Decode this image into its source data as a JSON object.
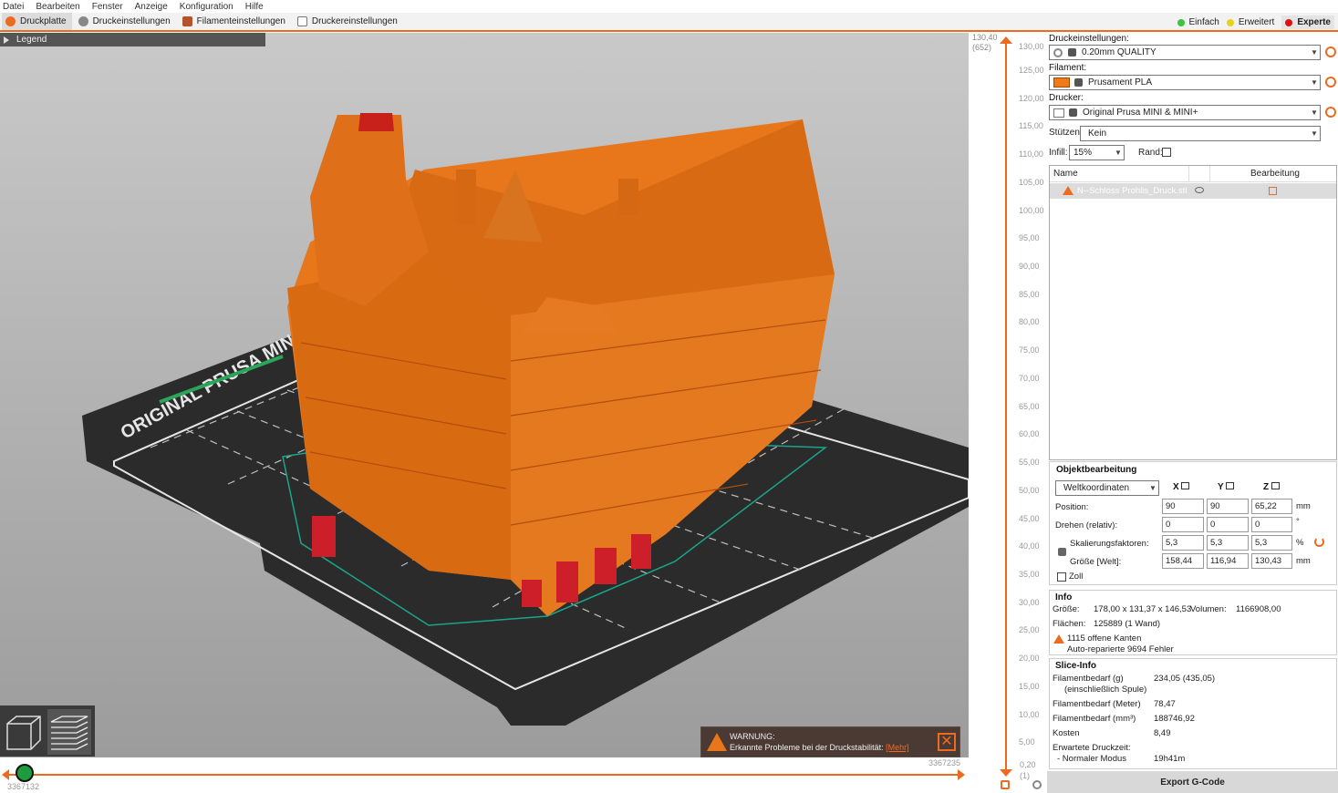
{
  "menu": [
    "Datei",
    "Bearbeiten",
    "Fenster",
    "Anzeige",
    "Konfiguration",
    "Hilfe"
  ],
  "tabs": [
    {
      "label": "Druckplatte",
      "color": "#ed6b21"
    },
    {
      "label": "Druckeinstellungen",
      "color": "#777777"
    },
    {
      "label": "Filamenteinstellungen",
      "color": "#b5532a"
    },
    {
      "label": "Druckereinstellungen",
      "color": "#777777"
    }
  ],
  "modes": [
    {
      "label": "Einfach",
      "color": "#3cc43c"
    },
    {
      "label": "Erweitert",
      "color": "#e8d21c"
    },
    {
      "label": "Experte",
      "color": "#e01010"
    }
  ],
  "legend": "Legend",
  "bed_label": "ORIGINAL PRUSA MINI",
  "vslider": {
    "top_value": "130,40",
    "top_layer": "(652)",
    "bottom_value": "0,20",
    "bottom_layer": "(1)",
    "ticks": [
      "130,00",
      "125,00",
      "120,00",
      "115,00",
      "110,00",
      "105,00",
      "100,00",
      "95,00",
      "90,00",
      "85,00",
      "80,00",
      "75,00",
      "70,00",
      "65,00",
      "60,00",
      "55,00",
      "50,00",
      "45,00",
      "40,00",
      "35,00",
      "30,00",
      "25,00",
      "20,00",
      "15,00",
      "10,00",
      "5,00"
    ]
  },
  "hslider": {
    "left_value": "3367132",
    "right_value": "3367235"
  },
  "warning": {
    "title": "WARNUNG:",
    "text": "Erkannte Probleme bei der Druckstabilität:",
    "link": "[Mehr]"
  },
  "panel": {
    "print_settings_label": "Druckeinstellungen:",
    "print_settings_value": "0.20mm QUALITY",
    "filament_label": "Filament:",
    "filament_value": "Prusament PLA",
    "filament_color": "#f07a1a",
    "printer_label": "Drucker:",
    "printer_value": "Original Prusa MINI & MINI+",
    "supports_label": "Stützen:",
    "supports_value": "Kein",
    "infill_label": "Infill:",
    "infill_value": "15%",
    "brim_label": "Rand:",
    "list_col_name": "Name",
    "list_col_edit": "Bearbeitung",
    "object_name": "N--Schloss Prohlis_Druck.stl",
    "obj_edit_title": "Objektbearbeitung",
    "coord_system": "Weltkoordinaten",
    "axis_x": "X",
    "axis_y": "Y",
    "axis_z": "Z",
    "position_label": "Position:",
    "position": [
      "90",
      "90",
      "65,22"
    ],
    "position_unit": "mm",
    "rotate_label": "Drehen (relativ):",
    "rotate": [
      "0",
      "0",
      "0"
    ],
    "rotate_unit": "°",
    "scale_label": "Skalierungsfaktoren:",
    "scale": [
      "5,3",
      "5,3",
      "5,3"
    ],
    "scale_unit": "%",
    "size_label": "Größe [Welt]:",
    "size": [
      "158,44",
      "116,94",
      "130,43"
    ],
    "size_unit": "mm",
    "inch_label": "Zoll",
    "info_title": "Info",
    "info_size_label": "Größe:",
    "info_size": "178,00 x 131,37 x 146,53",
    "info_volume_label": "Volumen:",
    "info_volume": "1166908,00",
    "info_facets_label": "Flächen:",
    "info_facets": "125889 (1 Wand)",
    "info_warn1": "1115 offene Kanten",
    "info_warn2": "Auto-reparierte 9694 Fehler",
    "slice_title": "Slice-Info",
    "fil_g_label": "Filamentbedarf (g)",
    "fil_g_sub": "(einschließlich Spule)",
    "fil_g": "234,05 (435,05)",
    "fil_m_label": "Filamentbedarf (Meter)",
    "fil_m": "78,47",
    "fil_mm3_label": "Filamentbedarf (mm³)",
    "fil_mm3": "188746,92",
    "cost_label": "Kosten",
    "cost": "8,49",
    "time_label": "Erwartete Druckzeit:",
    "time_mode": "- Normaler Modus",
    "time": "19h41m",
    "export": "Export G-Code"
  }
}
